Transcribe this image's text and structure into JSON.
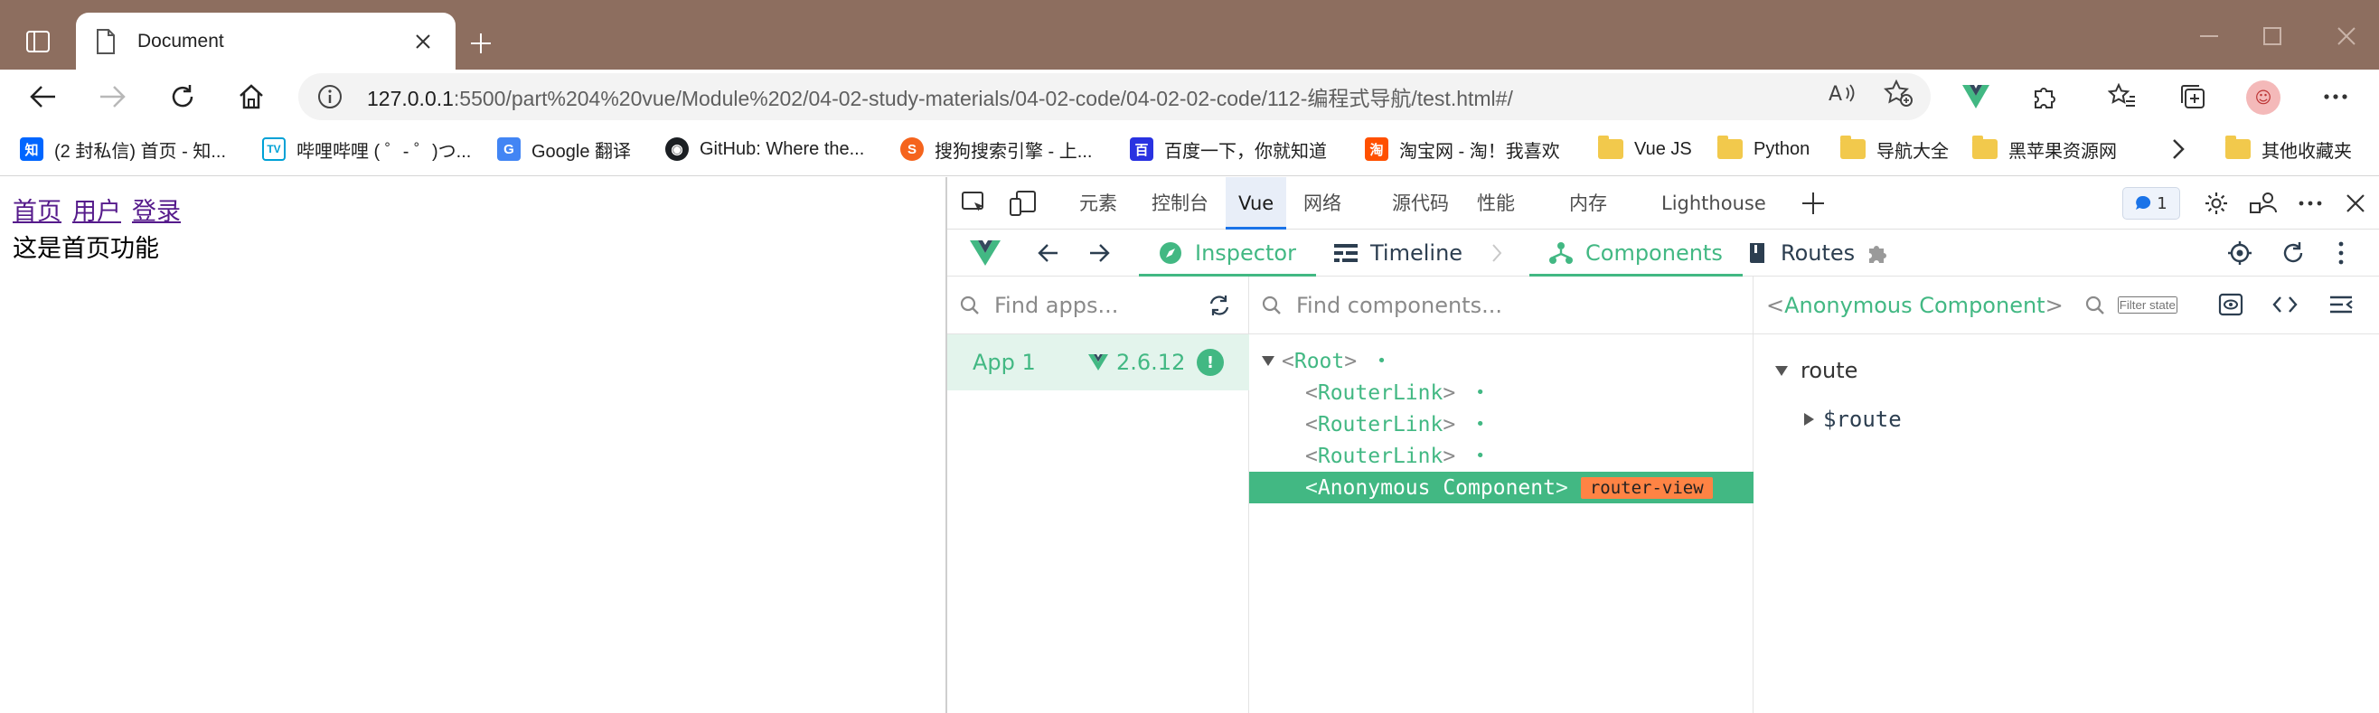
{
  "browser": {
    "tab_title": "Document",
    "url_host": "127.0.0.1",
    "url_rest": ":5500/part%204%20vue/Module%202/04-02-study-materials/04-02-code/04-02-02-code/112-编程式导航/test.html#/",
    "colors": {
      "titlebar": "#8d6e5f",
      "vue_green": "#42b883",
      "router_view_badge": "#ff8344"
    }
  },
  "bookmarks": [
    {
      "label": "(2 封私信) 首页 - 知...",
      "icon": "zhihu-icon"
    },
    {
      "label": "哔哩哔哩 ( ゜- ゜)つ...",
      "icon": "bilibili-icon"
    },
    {
      "label": "Google 翻译",
      "icon": "google-translate-icon"
    },
    {
      "label": "GitHub: Where the...",
      "icon": "github-icon"
    },
    {
      "label": "搜狗搜索引擎 - 上...",
      "icon": "sogou-icon"
    },
    {
      "label": "百度一下，你就知道",
      "icon": "baidu-icon"
    },
    {
      "label": "淘宝网 - 淘！我喜欢",
      "icon": "taobao-icon"
    },
    {
      "label": "Vue JS",
      "icon": "folder-icon"
    },
    {
      "label": "Python",
      "icon": "folder-icon"
    },
    {
      "label": "导航大全",
      "icon": "folder-icon"
    },
    {
      "label": "黑苹果资源网",
      "icon": "folder-icon"
    },
    {
      "label": "其他收藏夹",
      "icon": "folder-icon"
    }
  ],
  "page": {
    "links": [
      "首页",
      "用户",
      "登录"
    ],
    "text": "这是首页功能"
  },
  "devtools": {
    "tabs": [
      "元素",
      "控制台",
      "Vue",
      "网络",
      "源代码",
      "性能",
      "内存",
      "Lighthouse"
    ],
    "active_tab": "Vue",
    "issues_count": "1",
    "vue": {
      "toolbar": {
        "inspector": "Inspector",
        "timeline": "Timeline",
        "components": "Components",
        "routes": "Routes"
      },
      "apps": {
        "search_placeholder": "Find apps...",
        "app_name": "App 1",
        "version": "2.6.12",
        "warn": "!"
      },
      "tree": {
        "search_placeholder": "Find components...",
        "root": "Root",
        "router_links": [
          "RouterLink",
          "RouterLink",
          "RouterLink"
        ],
        "selected": "Anonymous Component",
        "selected_badge": "router-view"
      },
      "state": {
        "component_name": "Anonymous Component",
        "filter_placeholder": "Filter state...",
        "section": "route",
        "entry": "$route"
      }
    }
  }
}
